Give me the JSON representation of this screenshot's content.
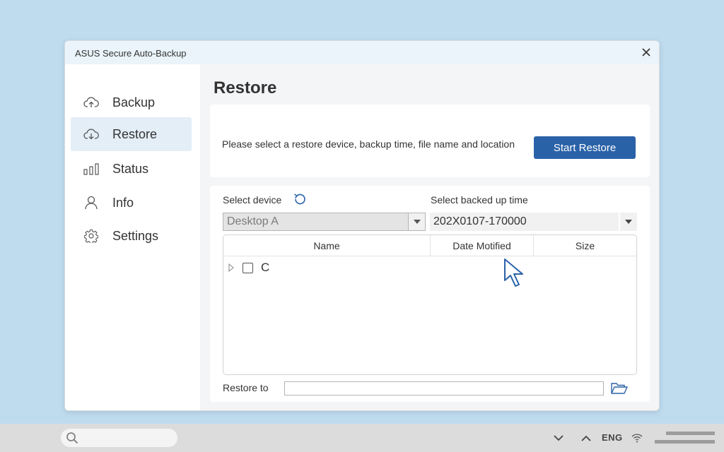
{
  "window": {
    "title": "ASUS Secure Auto-Backup"
  },
  "sidebar": {
    "items": [
      {
        "label": "Backup",
        "icon": "cloud-upload-icon",
        "active": false
      },
      {
        "label": "Restore",
        "icon": "cloud-download-icon",
        "active": true
      },
      {
        "label": "Status",
        "icon": "bar-chart-icon",
        "active": false
      },
      {
        "label": "Info",
        "icon": "user-icon",
        "active": false
      },
      {
        "label": "Settings",
        "icon": "gear-icon",
        "active": false
      }
    ]
  },
  "main": {
    "heading": "Restore",
    "instruction": "Please select a restore device, backup time, file name and location",
    "start_button": "Start Restore",
    "select_device_label": "Select device",
    "device_value": "Desktop A",
    "select_time_label": "Select backed up time",
    "time_value": "202X0107-170000",
    "table": {
      "columns": [
        "Name",
        "Date Motified",
        "Size"
      ],
      "rows": [
        {
          "name": "C"
        }
      ]
    },
    "restore_to_label": "Restore to",
    "restore_to_value": ""
  },
  "taskbar": {
    "language": "ENG"
  },
  "colors": {
    "accent": "#2a62a8",
    "background": "#bfdcef",
    "active_nav": "#e3eef7"
  }
}
